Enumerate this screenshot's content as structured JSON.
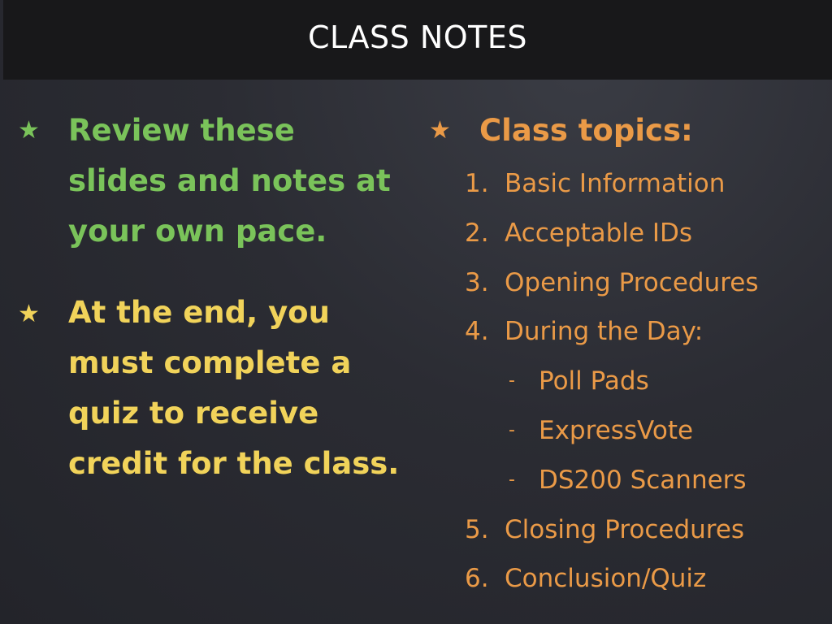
{
  "header": {
    "title": "CLASS NOTES"
  },
  "left_column": {
    "bullets": [
      {
        "icon": "star-icon",
        "color": "#7ac35a",
        "lines": [
          "Review these",
          "slides and notes at",
          "your own pace."
        ]
      },
      {
        "icon": "star-icon",
        "color": "#f1d35a",
        "lines": [
          "At the end, you",
          "must complete a",
          "quiz to receive",
          "credit for the class."
        ]
      }
    ]
  },
  "right_column": {
    "icon": "star-icon",
    "color": "#ea9a47",
    "heading": "Class topics:",
    "topics": [
      {
        "number": "1.",
        "label": "Basic Information"
      },
      {
        "number": "2.",
        "label": "Acceptable IDs"
      },
      {
        "number": "3.",
        "label": "Opening Procedures"
      },
      {
        "number": "4.",
        "label": "During the Day:"
      },
      {
        "marker": "-",
        "label": "Poll Pads"
      },
      {
        "marker": "-",
        "label": "ExpressVote"
      },
      {
        "marker": "-",
        "label": "DS200 Scanners"
      },
      {
        "number": "5.",
        "label": "Closing Procedures"
      },
      {
        "number": "6.",
        "label": "Conclusion/Quiz"
      }
    ]
  },
  "colors": {
    "background": "#2b2c33",
    "title_bar": "#18181a",
    "green": "#7ac35a",
    "yellow": "#f1d35a",
    "orange": "#ea9a47"
  }
}
